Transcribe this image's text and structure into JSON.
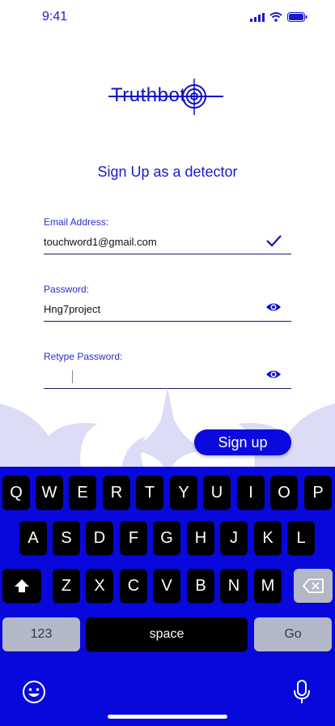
{
  "status": {
    "time": "9:41"
  },
  "logo": {
    "text": "Truthbot"
  },
  "subtitle": "Sign Up as a detector",
  "form": {
    "email": {
      "label": "Email Address:",
      "value": "touchword1@gmail.com"
    },
    "password": {
      "label": "Password:",
      "value": "Hng7project"
    },
    "retype": {
      "label": "Retype Password:",
      "value": ""
    }
  },
  "signup_button": "Sign up",
  "keyboard": {
    "row1": [
      "Q",
      "W",
      "E",
      "R",
      "T",
      "Y",
      "U",
      "I",
      "O",
      "P"
    ],
    "row2": [
      "A",
      "S",
      "D",
      "F",
      "G",
      "H",
      "J",
      "K",
      "L"
    ],
    "row3": [
      "Z",
      "X",
      "C",
      "V",
      "B",
      "N",
      "M"
    ],
    "numbers": "123",
    "space": "space",
    "go": "Go"
  },
  "colors": {
    "accent": "#0a0adf",
    "keyboard_bg": "#0808dd"
  }
}
